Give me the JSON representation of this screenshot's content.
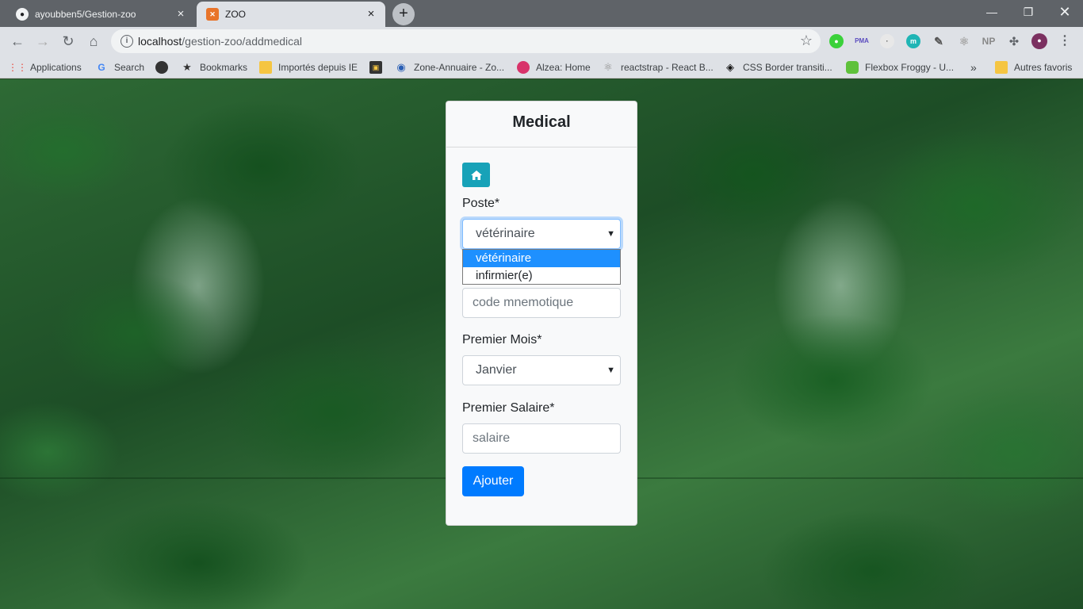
{
  "browser": {
    "tabs": [
      {
        "title": "ayoubben5/Gestion-zoo",
        "icon": "github-icon",
        "active": false
      },
      {
        "title": "ZOO",
        "icon": "xampp-icon",
        "active": true
      }
    ],
    "url_host": "localhost",
    "url_path": "/gestion-zoo/addmedical",
    "bookmarks": [
      {
        "label": "Applications",
        "icon": "apps-grid-icon"
      },
      {
        "label": "Search",
        "icon": "google-icon"
      },
      {
        "label": "",
        "icon": "circle-icon"
      },
      {
        "label": "Bookmarks",
        "icon": "star-icon"
      },
      {
        "label": "Importés depuis IE",
        "icon": "folder-icon"
      },
      {
        "label": "",
        "icon": "box-icon"
      },
      {
        "label": "Zone-Annuaire - Zo...",
        "icon": "globe-icon"
      },
      {
        "label": "Alzea: Home",
        "icon": "alzea-icon"
      },
      {
        "label": "reactstrap - React B...",
        "icon": "react-icon"
      },
      {
        "label": "CSS Border transiti...",
        "icon": "codepen-icon"
      },
      {
        "label": "Flexbox Froggy - U...",
        "icon": "frog-icon"
      },
      {
        "label": "Autres favoris",
        "icon": "folder-icon"
      }
    ],
    "more_bookmarks": "»",
    "extensions": [
      "PMA",
      "NP"
    ]
  },
  "form": {
    "title": "Medical",
    "poste_label": "Poste*",
    "poste_value": "vétérinaire",
    "poste_options": [
      "vétérinaire",
      "infirmier(e)"
    ],
    "code_placeholder": "code mnemotique",
    "mois_label": "Premier Mois*",
    "mois_value": "Janvier",
    "salaire_label": "Premier Salaire*",
    "salaire_placeholder": "salaire",
    "submit_label": "Ajouter"
  },
  "colors": {
    "accent": "#007bff",
    "info": "#17a2b8",
    "dropdown_highlight": "#1e90ff"
  }
}
